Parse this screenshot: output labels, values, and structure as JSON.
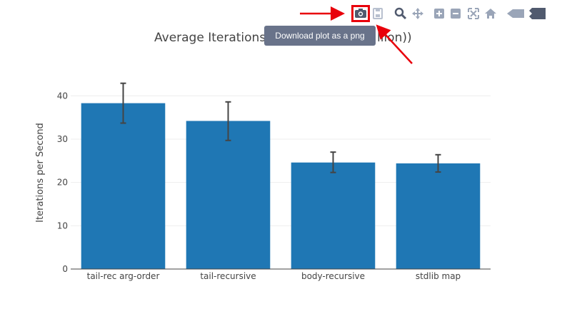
{
  "chart_data": {
    "type": "bar",
    "title": "Average Iterations per Second (Mi",
    "title_tail": "llion))",
    "ylabel": "Iterations per Second",
    "xlabel": "",
    "categories": [
      "tail-rec arg-order",
      "tail-recursive",
      "body-recursive",
      "stdlib map"
    ],
    "values": [
      38.3,
      34.2,
      24.6,
      24.4
    ],
    "error_low": [
      33.7,
      29.7,
      22.3,
      22.4
    ],
    "error_high": [
      42.9,
      38.6,
      27.0,
      26.4
    ],
    "ylim": [
      0,
      44
    ],
    "yticks": [
      0,
      10,
      20,
      30,
      40
    ],
    "grid": true,
    "bar_color": "#1f77b4"
  },
  "tooltip": {
    "text": "Download plot as a png"
  },
  "modebar": {
    "buttons": [
      "camera-icon",
      "save-icon",
      "zoom-icon",
      "pan-icon",
      "zoom-in-icon",
      "zoom-out-icon",
      "autoscale-icon",
      "home-icon",
      "spike-lines-icon",
      "compare-data-icon"
    ]
  },
  "colors": {
    "annotation": "#e8000b",
    "icon": "#9aa5b8",
    "icon_active": "#505a6e"
  }
}
